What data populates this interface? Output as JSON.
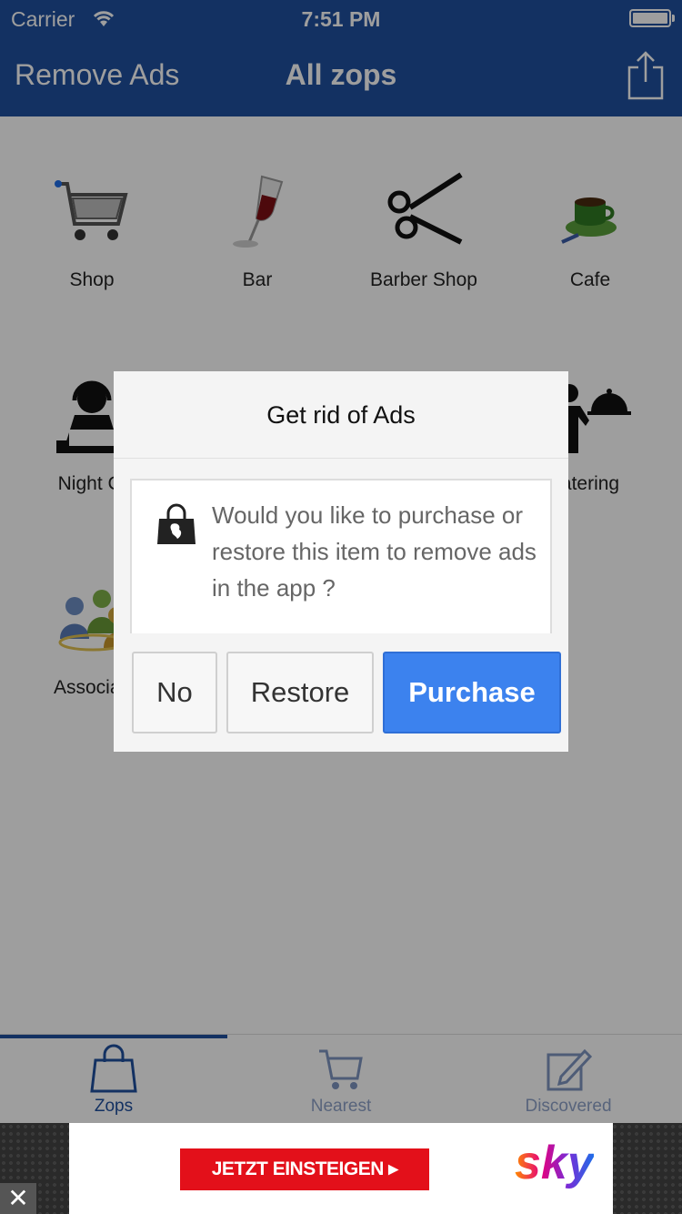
{
  "status_bar": {
    "carrier": "Carrier",
    "time": "7:51 PM"
  },
  "nav": {
    "left_button": "Remove Ads",
    "title": "All zops",
    "share_icon": "share-icon"
  },
  "categories": [
    {
      "label": "Shop",
      "icon": "shopping-cart-icon"
    },
    {
      "label": "Bar",
      "icon": "wine-glass-icon"
    },
    {
      "label": "Barber Shop",
      "icon": "scissors-icon"
    },
    {
      "label": "Cafe",
      "icon": "coffee-cup-icon"
    },
    {
      "label": "Night Cl",
      "icon": "dj-headphones-icon"
    },
    {
      "label": "atering",
      "icon": "waiter-cloche-icon"
    },
    {
      "label": "Associati",
      "icon": "people-group-icon"
    }
  ],
  "tabs": [
    {
      "label": "Zops",
      "icon": "shopping-bag-icon",
      "active": true
    },
    {
      "label": "Nearest",
      "icon": "cart-icon",
      "active": false
    },
    {
      "label": "Discovered",
      "icon": "edit-note-icon",
      "active": false
    }
  ],
  "ad": {
    "cta": "JETZT EINSTEIGEN ▸",
    "brand": "sky",
    "close": "✕"
  },
  "dialog": {
    "title": "Get rid of Ads",
    "message": "Would you like to purchase or restore this item to remove ads in the app ?",
    "buttons": {
      "no": "No",
      "restore": "Restore",
      "purchase": "Purchase"
    }
  },
  "colors": {
    "nav_blue": "#1f4f9e",
    "purchase_blue": "#3c82ee",
    "ad_red": "#e3101a"
  }
}
